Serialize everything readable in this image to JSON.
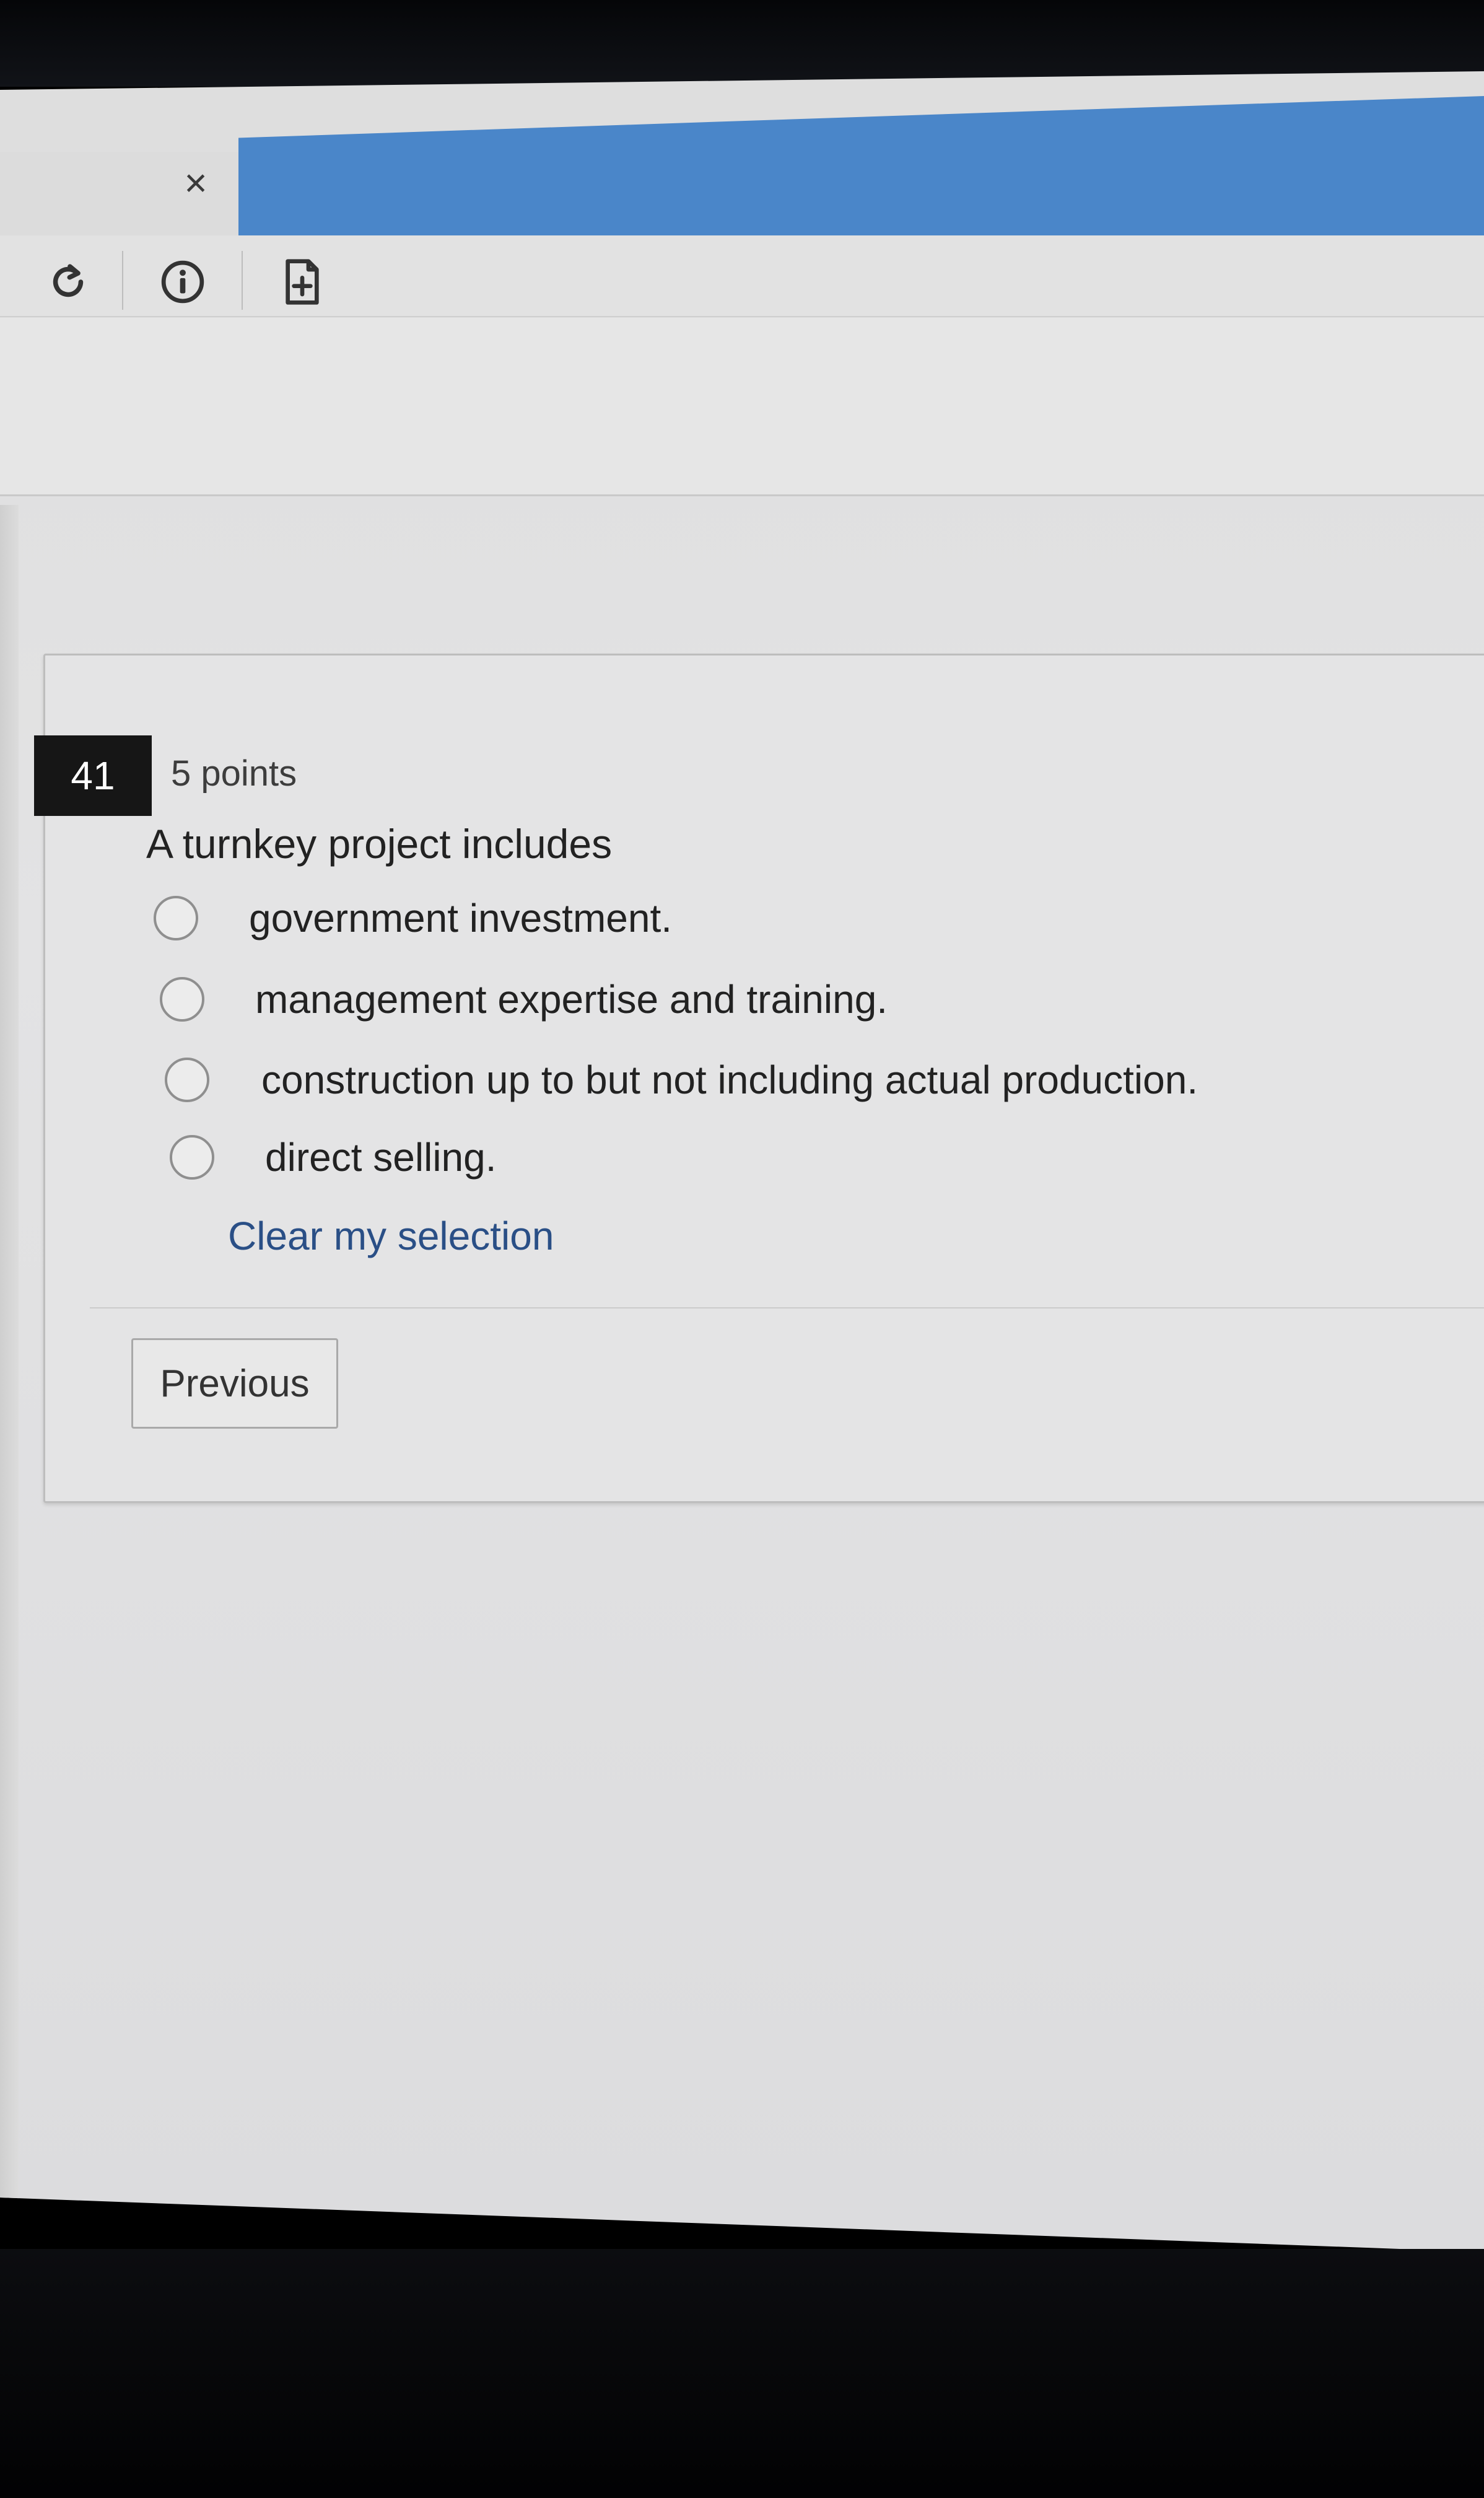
{
  "browser": {
    "close_icon": "close-icon",
    "close_glyph": "×",
    "toolbar_icons": [
      "reload-icon",
      "info-icon",
      "add-file-icon"
    ]
  },
  "question": {
    "number": "41",
    "points": "5 points",
    "text": "A turnkey project includes",
    "options": [
      {
        "label": "government investment.",
        "selected": false
      },
      {
        "label": "management expertise and training.",
        "selected": false
      },
      {
        "label": "construction up to but not including actual production.",
        "selected": false
      },
      {
        "label": "direct selling.",
        "selected": false
      }
    ],
    "clear_label": "Clear my selection"
  },
  "navigation": {
    "previous_label": "Previous"
  },
  "colors": {
    "accent_blue": "#4a86c9",
    "link": "#2a4f86",
    "number_badge": "#161616"
  }
}
